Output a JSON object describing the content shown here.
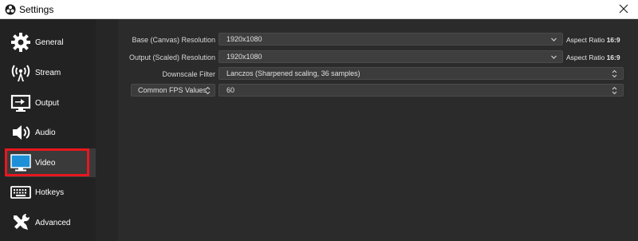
{
  "window": {
    "title": "Settings",
    "app_icon": "obs-logo-icon",
    "close_icon": "close-icon"
  },
  "sidebar": {
    "items": [
      {
        "label": "General",
        "icon": "gear-icon",
        "selected": false
      },
      {
        "label": "Stream",
        "icon": "broadcast-icon",
        "selected": false
      },
      {
        "label": "Output",
        "icon": "output-monitor-icon",
        "selected": false
      },
      {
        "label": "Audio",
        "icon": "speaker-icon",
        "selected": false
      },
      {
        "label": "Video",
        "icon": "monitor-icon",
        "selected": true
      },
      {
        "label": "Hotkeys",
        "icon": "keyboard-icon",
        "selected": false
      },
      {
        "label": "Advanced",
        "icon": "tools-icon",
        "selected": false
      }
    ],
    "highlight_color": "#e8171f"
  },
  "video": {
    "base_resolution": {
      "label": "Base (Canvas) Resolution",
      "value": "1920x1080",
      "aspect_prefix": "Aspect Ratio",
      "aspect_value": "16:9"
    },
    "output_resolution": {
      "label": "Output (Scaled) Resolution",
      "value": "1920x1080",
      "aspect_prefix": "Aspect Ratio",
      "aspect_value": "16:9"
    },
    "downscale_filter": {
      "label": "Downscale Filter",
      "value": "Lanczos (Sharpened scaling, 36 samples)"
    },
    "fps": {
      "mode": "Common FPS Values",
      "value": "60"
    }
  },
  "colors": {
    "background": "#2b2b2b",
    "sidebar": "#222222",
    "field": "#3c3c3c",
    "text": "#e0e0e0",
    "accent_red": "#e8171f"
  }
}
